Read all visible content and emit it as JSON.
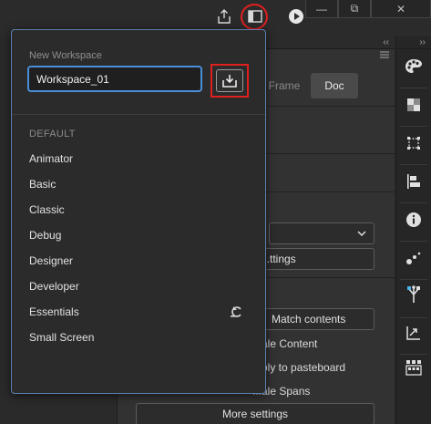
{
  "window_controls": {
    "minimize": "—",
    "restore": "⧉",
    "close": "✕"
  },
  "toolbar": {
    "icons": [
      "publish-icon",
      "workspace-icon",
      "play-icon"
    ]
  },
  "panel": {
    "collapse_glyph": "‹‹",
    "tabs": {
      "frame": "Frame",
      "doc": "Doc"
    },
    "settings_button": "...ttings",
    "match_contents": "Match contents",
    "scale_content": "...ale Content",
    "apply_pasteboard": "...ply to pasteboard",
    "scale_spans": "...ale Spans",
    "more_settings": "More settings"
  },
  "right_dock": {
    "collapse_glyph": "››",
    "icons": [
      "color-palette-icon",
      "swatches-icon",
      "transform-icon",
      "align-icon",
      "info-icon",
      "motion-presets-icon",
      "components-icon",
      "output-icon",
      "library-icon"
    ]
  },
  "workspace_popup": {
    "label": "New Workspace",
    "input_value": "Workspace_01",
    "section_title": "DEFAULT",
    "items": [
      "Animator",
      "Basic",
      "Classic",
      "Debug",
      "Designer",
      "Developer",
      "Essentials",
      "Small Screen"
    ]
  }
}
